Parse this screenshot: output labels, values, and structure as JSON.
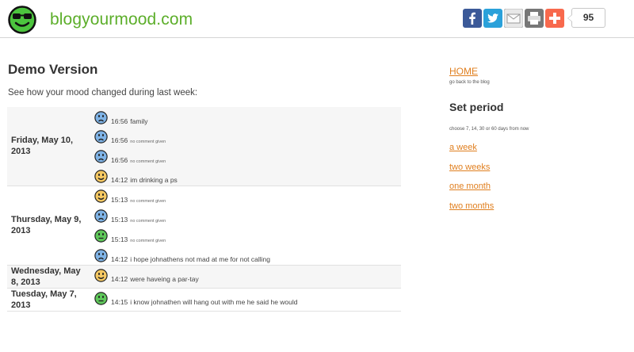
{
  "header": {
    "site_title": "blogyourmood.com",
    "share_count": "95",
    "share_buttons": [
      "facebook-icon",
      "twitter-icon",
      "email-icon",
      "print-icon",
      "addthis-plus-icon"
    ]
  },
  "main": {
    "title": "Demo Version",
    "intro": "See how your mood changed during last week:",
    "days": [
      {
        "label_line1": "Friday, May 10,",
        "label_line2": "2013",
        "entries": [
          {
            "mood": "sad",
            "time": "16:56",
            "comment": "family"
          },
          {
            "mood": "sad",
            "time": "16:56",
            "comment": "no comment given"
          },
          {
            "mood": "sad",
            "time": "16:56",
            "comment": "no comment given"
          },
          {
            "mood": "happy",
            "time": "14:12",
            "comment": "im drinking a ps"
          }
        ]
      },
      {
        "label_line1": "Thursday, May 9,",
        "label_line2": "2013",
        "entries": [
          {
            "mood": "happy",
            "time": "15:13",
            "comment": "no comment given"
          },
          {
            "mood": "sad",
            "time": "15:13",
            "comment": "no comment given"
          },
          {
            "mood": "neutral",
            "time": "15:13",
            "comment": "no comment given"
          },
          {
            "mood": "sad",
            "time": "14:12",
            "comment": "i hope johnathens not mad at me for not calling"
          }
        ]
      },
      {
        "label_line1": "Wednesday, May",
        "label_line2": "8, 2013",
        "entries": [
          {
            "mood": "happy",
            "time": "14:12",
            "comment": "were haveing a par-tay"
          }
        ]
      },
      {
        "label_line1": "Tuesday, May 7,",
        "label_line2": "2013",
        "entries": [
          {
            "mood": "neutral",
            "time": "14:15",
            "comment": "i know johnathen will hang out with me he said he would"
          }
        ]
      }
    ]
  },
  "sidebar": {
    "home_label": "HOME",
    "home_sub": "go back to the blog",
    "set_period": "Set period",
    "period_hint": "choose 7, 14, 30 or 60 days from now",
    "periods": [
      "a week",
      "two weeks",
      "one month",
      "two months"
    ]
  },
  "colors": {
    "brand_green": "#5cae2a",
    "link_orange": "#e07f1f",
    "mood_sad": "#7fb3e6",
    "mood_happy": "#f5c862",
    "mood_neutral": "#5fc85a"
  }
}
